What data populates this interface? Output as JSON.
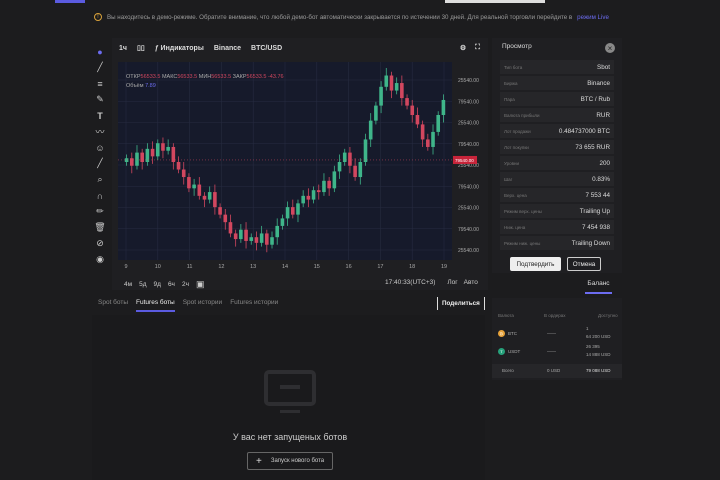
{
  "notice": {
    "text": "Вы находитесь в демо-режиме. Обратите внимание, что любой демо-бот автоматически закрывается по истечении 30 дней. Для реальной торговли перейдите в",
    "link": "режим Live"
  },
  "chart_toolbar": {
    "interval": "1ч",
    "indicators": "Индикаторы",
    "exchange": "Binance",
    "pair": "BTC/USD"
  },
  "legend": {
    "open_label": "ОТКР",
    "open": "56533.5",
    "high_label": "МАКС",
    "high": "56533.5",
    "low_label": "МИН",
    "low": "56533.5",
    "close_label": "ЗАКР",
    "close": "56533.5",
    "change": "-43.76",
    "volume_label": "Объём",
    "volume": "7.89"
  },
  "timeframes": [
    "4м",
    "5д",
    "9д",
    "6ч",
    "2ч"
  ],
  "time_info": {
    "time": "17:40:33(UTC+3)",
    "log": "Лог",
    "auto": "Авто"
  },
  "tabs": [
    "Spot боты",
    "Futures боты",
    "Spot истории",
    "Futures истории"
  ],
  "share": "Поделиться",
  "empty": {
    "text": "У вас нет запущеных ботов",
    "button": "Запуск нового бота"
  },
  "panel": {
    "title": "Просмотр",
    "rows": [
      {
        "k": "Тип бота",
        "v": "Sbot"
      },
      {
        "k": "Биржа",
        "v": "Binance"
      },
      {
        "k": "Пара",
        "v": "BTC / Rub"
      },
      {
        "k": "Валюта прибыли",
        "v": "RUR"
      },
      {
        "k": "Лот продажи",
        "v": "0.484737000 BTC"
      },
      {
        "k": "Лот покупки",
        "v": "73 655 RUR"
      },
      {
        "k": "Уровни",
        "v": "200"
      },
      {
        "k": "Шаг",
        "v": "0.83%"
      },
      {
        "k": "Верх. цена",
        "v": "7 553 44"
      },
      {
        "k": "Режим верх. цены",
        "v": "Trailing Up"
      },
      {
        "k": "Ниж. цена",
        "v": "7 454 938"
      },
      {
        "k": "Режим ниж. цены",
        "v": "Trailing Down"
      }
    ],
    "confirm": "Подтвердить",
    "cancel": "Отмена"
  },
  "balance": {
    "tab": "Баланс",
    "headers": [
      "Валюта",
      "В ордерах",
      "Доступно"
    ],
    "rows": [
      {
        "coin": "BTC",
        "orders": "——",
        "avail": "1",
        "avail_usd": "64 200 USD",
        "color": "#e8a33a"
      },
      {
        "coin": "USDT",
        "orders": "——",
        "avail": "26 395",
        "avail_usd": "14 888 USD",
        "color": "#26a17b"
      }
    ],
    "total": {
      "label": "Всего",
      "orders": "0 USD",
      "avail": "79 088 USD"
    }
  },
  "chart_data": {
    "type": "candlestick",
    "x_ticks": [
      "9",
      "10",
      "11",
      "12",
      "13",
      "14",
      "15",
      "16",
      "17",
      "18",
      "19"
    ],
    "y_ticks": [
      "25540.00",
      "79540.00",
      "25540.00",
      "79540.00",
      "25540.00",
      "79540.00",
      "25540.00",
      "79540.00",
      "25540.00"
    ],
    "current_price": "79540.00",
    "closes": [
      52,
      48,
      55,
      50,
      57,
      53,
      60,
      56,
      58,
      50,
      46,
      42,
      36,
      38,
      32,
      30,
      34,
      26,
      22,
      18,
      12,
      9,
      14,
      8,
      10,
      7,
      12,
      6,
      10,
      16,
      20,
      26,
      22,
      28,
      32,
      30,
      35,
      34,
      40,
      36,
      45,
      50,
      55,
      48,
      42,
      50,
      62,
      72,
      80,
      90,
      96,
      88,
      92,
      84,
      80,
      75,
      70,
      62,
      58,
      66,
      75,
      83
    ],
    "up_color": "#3fb58a",
    "down_color": "#d2475f"
  }
}
